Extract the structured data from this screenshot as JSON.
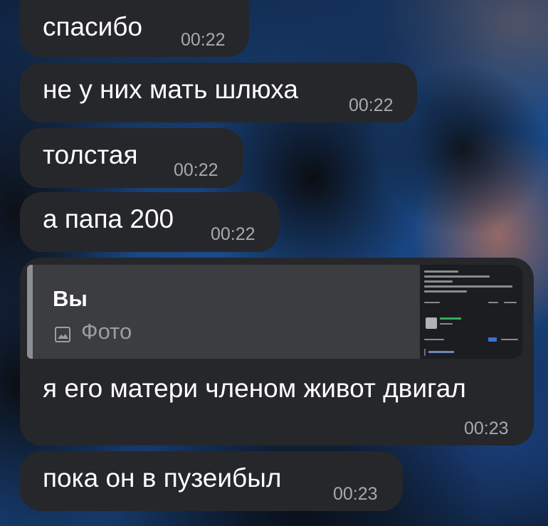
{
  "messages": [
    {
      "text": "спасибо",
      "time": "00:22"
    },
    {
      "text": "не у них мать шлюха",
      "time": "00:22"
    },
    {
      "text": "толстая",
      "time": "00:22"
    },
    {
      "text": "а папа 200",
      "time": "00:22"
    },
    {
      "reply": {
        "author": "Вы",
        "kind": "Фото",
        "kind_icon": "photo-icon"
      },
      "text": "я его матери членом живот двигал",
      "time": "00:23"
    },
    {
      "text": "пока он в пузеибыл",
      "time": "00:23"
    }
  ],
  "colors": {
    "bubble": "#26272b",
    "reply_card": "#3c3d41",
    "time": "#a8a9ad",
    "wallpaper": "#1a4a8a"
  }
}
